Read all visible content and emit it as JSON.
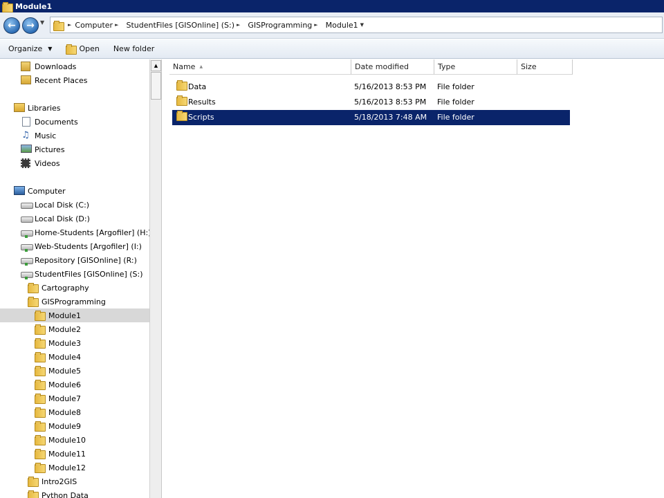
{
  "window": {
    "title": "Module1"
  },
  "address": {
    "crumbs": [
      "Computer",
      "StudentFiles [GISOnline] (S:)",
      "GISProgramming",
      "Module1"
    ]
  },
  "toolbar": {
    "organize": "Organize",
    "open": "Open",
    "new_folder": "New folder"
  },
  "nav": {
    "downloads": "Downloads",
    "recent": "Recent Places",
    "libraries": "Libraries",
    "documents": "Documents",
    "music": "Music",
    "pictures": "Pictures",
    "videos": "Videos",
    "computer": "Computer",
    "local_c": "Local Disk (C:)",
    "local_d": "Local Disk (D:)",
    "home": "Home-Students [Argofiler] (H:)",
    "web": "Web-Students [Argofiler] (I:)",
    "repo": "Repository [GISOnline] (R:)",
    "student": "StudentFiles [GISOnline] (S:)",
    "cartography": "Cartography",
    "gisprog": "GISProgramming",
    "modules": [
      "Module1",
      "Module2",
      "Module3",
      "Module4",
      "Module5",
      "Module6",
      "Module7",
      "Module8",
      "Module9",
      "Module10",
      "Module11",
      "Module12"
    ],
    "intro": "Intro2GIS",
    "python": "Python Data"
  },
  "columns": {
    "name": "Name",
    "date": "Date modified",
    "type": "Type",
    "size": "Size"
  },
  "files": [
    {
      "name": "Data",
      "date": "5/16/2013 8:53 PM",
      "type": "File folder"
    },
    {
      "name": "Results",
      "date": "5/16/2013 8:53 PM",
      "type": "File folder"
    },
    {
      "name": "Scripts",
      "date": "5/18/2013 7:48 AM",
      "type": "File folder"
    }
  ]
}
